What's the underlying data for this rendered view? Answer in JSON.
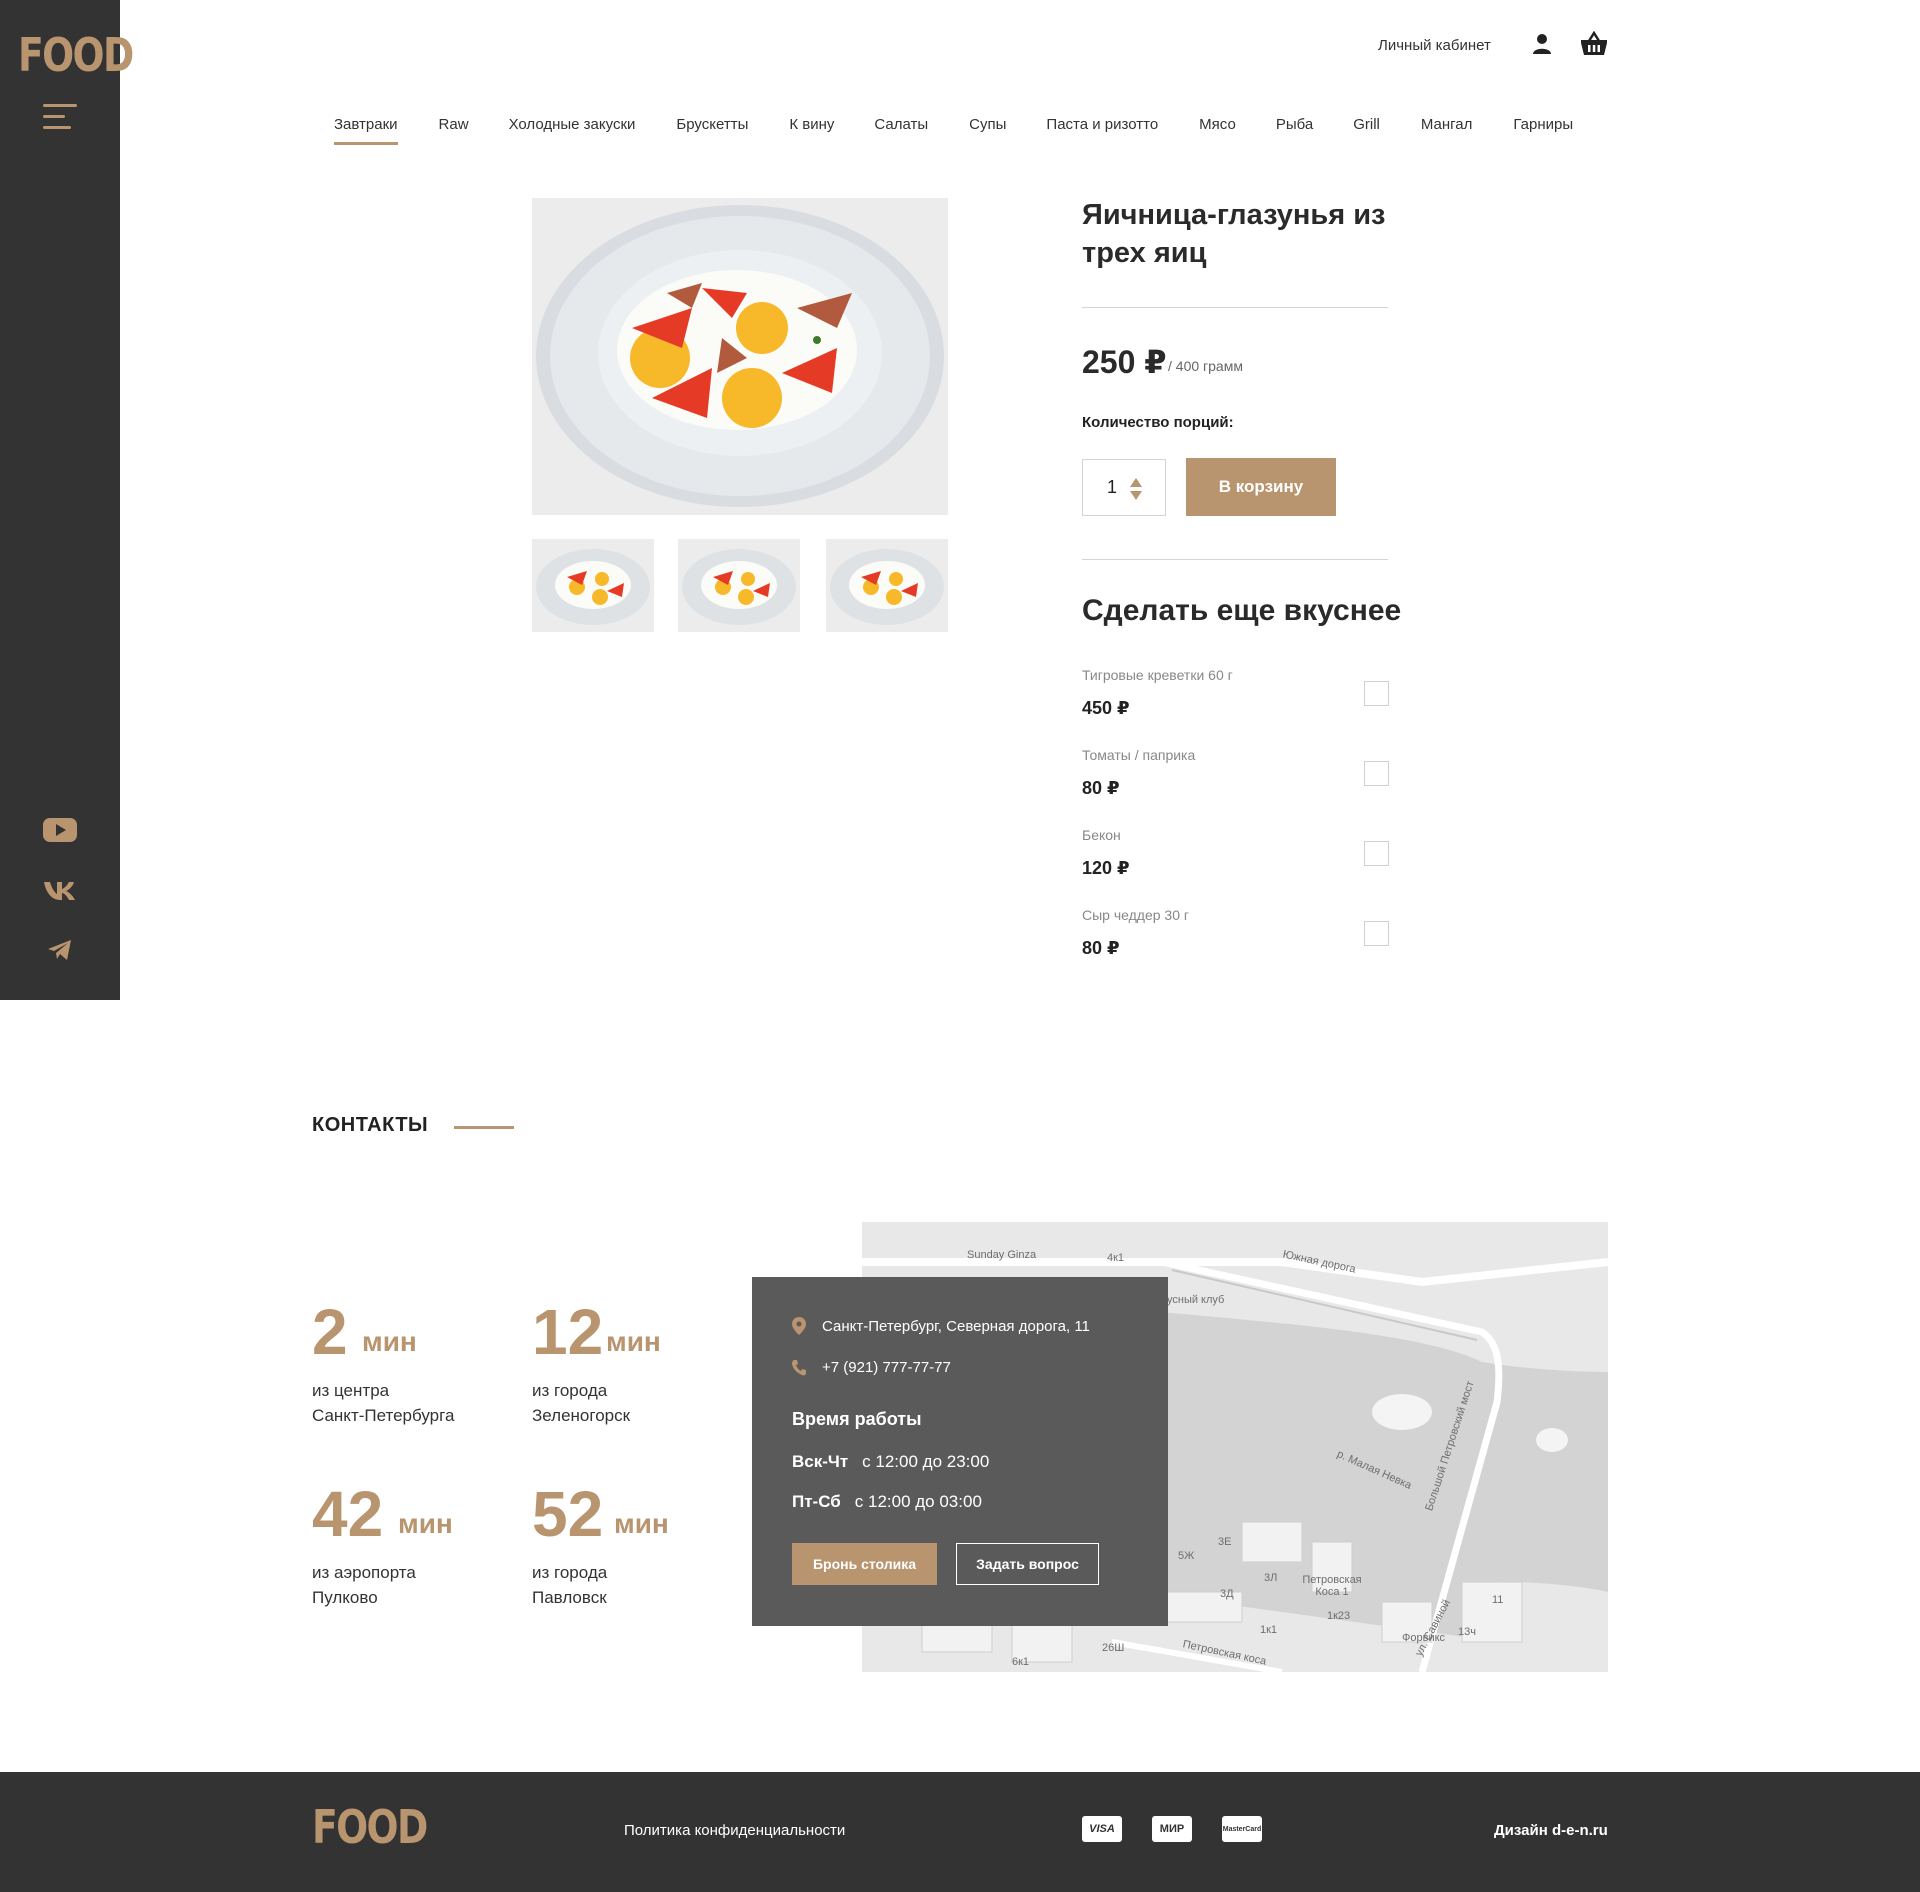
{
  "brand": {
    "logo": "FOOD"
  },
  "sidebar": {
    "icons": [
      "menu-icon",
      "youtube-icon",
      "vk-icon",
      "telegram-icon"
    ]
  },
  "header": {
    "cabinet_label": "Личный кабинет"
  },
  "nav": {
    "items": [
      "Завтраки",
      "Raw",
      "Холодные закуски",
      "Брускетты",
      "К вину",
      "Салаты",
      "Супы",
      "Паста и ризотто",
      "Мясо",
      "Рыба",
      "Grill",
      "Мангал",
      "Гарниры"
    ],
    "active": "Завтраки"
  },
  "product": {
    "title": "Яичница-глазунья из трех яиц",
    "price": "250 ₽",
    "weight": "/   400 грамм",
    "qty_label": "Количество порций:",
    "qty_value": "1",
    "cart_button": "В корзину"
  },
  "extras": {
    "title": "Сделать еще вкуснее",
    "items": [
      {
        "name": "Тигровые креветки 60 г",
        "price": "450 ₽"
      },
      {
        "name": "Томаты / паприка",
        "price": "80 ₽"
      },
      {
        "name": "Бекон",
        "price": "120 ₽"
      },
      {
        "name": "Сыр чеддер 30 г",
        "price": "80 ₽"
      }
    ]
  },
  "contacts": {
    "title": "КОНТАКТЫ",
    "stats": [
      {
        "num": "2",
        "unit": "мин",
        "line1": "из центра",
        "line2": "Санкт-Петербурга"
      },
      {
        "num": "12",
        "unit": "мин",
        "line1": "из города",
        "line2": "Зеленогорск"
      },
      {
        "num": "42",
        "unit": "мин",
        "line1": "из аэропорта",
        "line2": "Пулково"
      },
      {
        "num": "52",
        "unit": "мин",
        "line1": "из города",
        "line2": "Павловск"
      }
    ],
    "address": "Санкт-Петербург, Северная дорога, 11",
    "phone": "+7 (921) 777-77-77",
    "hours_title": "Время работы",
    "hours": [
      {
        "days": "Вск-Чт",
        "time": "с 12:00 до 23:00"
      },
      {
        "days": "Пт-Сб",
        "time": "с 12:00 до 03:00"
      }
    ],
    "book_button": "Бронь столика",
    "ask_button": "Задать вопрос"
  },
  "map": {
    "labels": [
      "Sunday Ginza",
      "Южная дорога",
      "усный клуб",
      "р. Малая Невка",
      "Большой Петровский мост",
      "Петровская Коса 1",
      "ул. Савиной",
      "Форвикс",
      "Петровская коса",
      "4к1",
      "5Ж",
      "3Е",
      "3Д",
      "3Л",
      "1к23",
      "1к1",
      "26Ш",
      "6к1",
      "13ч",
      "11"
    ]
  },
  "footer": {
    "privacy": "Политика конфиденциальности",
    "payments": [
      "VISA",
      "МИР",
      "MasterCard"
    ],
    "design": "Дизайн d-e-n.ru"
  },
  "colors": {
    "accent": "#b8946f",
    "dark": "#333333",
    "card": "#5a5a5a"
  }
}
